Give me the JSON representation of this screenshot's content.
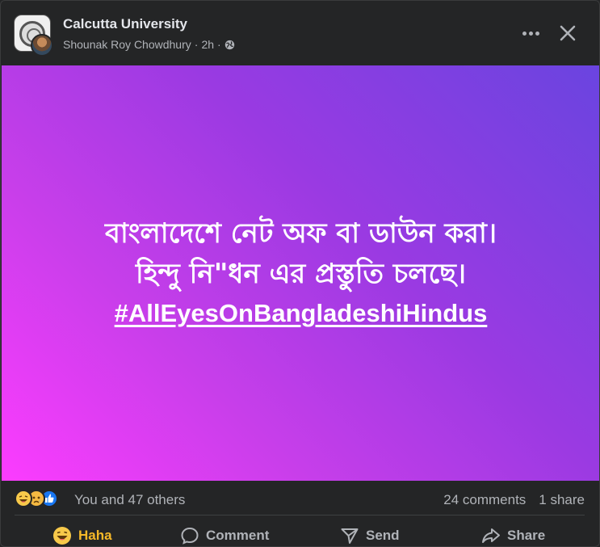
{
  "post": {
    "group_name": "Calcutta University",
    "author": "Shounak Roy Chowdhury",
    "time": "2h",
    "separator": "·",
    "privacy_icon": "globe-icon"
  },
  "media": {
    "line1": "বাংলাদেশে নেট অফ বা ডাউন করা।",
    "line2": "হিন্দু নি\"ধন এর প্রস্তুতি চলছে।",
    "hashtag": "#AllEyesOnBangladeshiHindus",
    "gradient_colors": [
      "#fc3cff",
      "#6a44e0"
    ]
  },
  "stats": {
    "reactions": [
      "haha",
      "sad",
      "like"
    ],
    "reactors": "You and 47 others",
    "comments": "24 comments",
    "shares": "1 share"
  },
  "actions": {
    "react_label": "Haha",
    "comment_label": "Comment",
    "send_label": "Send",
    "share_label": "Share",
    "active_color": "#f7b928"
  }
}
